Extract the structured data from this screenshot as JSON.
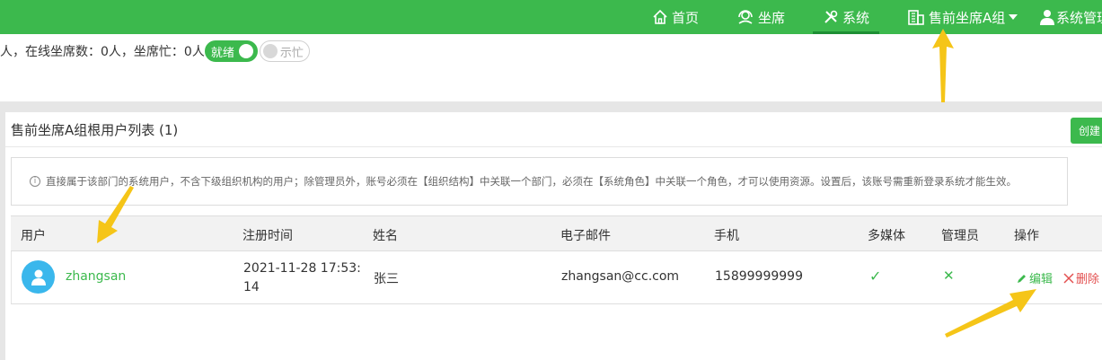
{
  "nav": {
    "items": [
      {
        "label": "首页",
        "icon": "home-icon"
      },
      {
        "label": "坐席",
        "icon": "headset-icon"
      },
      {
        "label": "系统",
        "icon": "tools-icon",
        "active": true
      },
      {
        "label": "售前坐席A组",
        "icon": "building-icon"
      },
      {
        "label": "系统管理",
        "icon": "user-icon"
      }
    ]
  },
  "status": {
    "text": "人，在线坐席数：0人，坐席忙：0人",
    "ready_label": "就绪",
    "busy_label": "示忙"
  },
  "panel": {
    "title": "售前坐席A组根用户列表 (1)",
    "create_label": "创建",
    "notice": "直接属于该部门的系统用户，不含下级组织机构的用户；除管理员外，账号必须在【组织结构】中关联一个部门，必须在【系统角色】中关联一个角色，才可以使用资源。设置后，该账号需重新登录系统才能生效。"
  },
  "table": {
    "headers": [
      "用户",
      "注册时间",
      "姓名",
      "电子邮件",
      "手机",
      "多媒体",
      "管理员",
      "操作"
    ],
    "rows": [
      {
        "user": "zhangsan",
        "registered_line1": "2021-11-28 17:53:",
        "registered_line2": "14",
        "name": "张三",
        "email": "zhangsan@cc.com",
        "phone": "15899999999",
        "multimedia": "✓",
        "admin": "✕",
        "edit_label": "编辑",
        "delete_label": "删除"
      }
    ]
  },
  "colors": {
    "brand": "#3cb94d",
    "annotation": "#f5c518",
    "danger": "#e35050"
  }
}
